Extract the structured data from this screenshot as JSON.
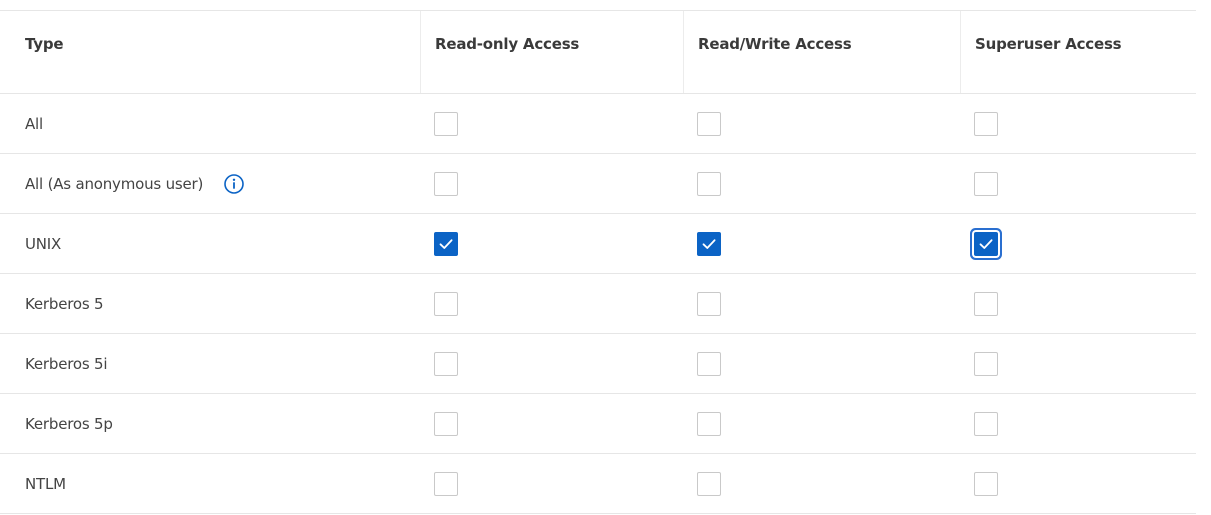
{
  "header": {
    "type": "Type",
    "read_only": "Read-only Access",
    "read_write": "Read/Write Access",
    "superuser": "Superuser Access"
  },
  "rows": [
    {
      "label": "All",
      "read_only": false,
      "read_write": false,
      "superuser": false,
      "info": false
    },
    {
      "label": "All (As anonymous user)",
      "read_only": false,
      "read_write": false,
      "superuser": false,
      "info": true
    },
    {
      "label": "UNIX",
      "read_only": true,
      "read_write": true,
      "superuser": true,
      "info": false
    },
    {
      "label": "Kerberos 5",
      "read_only": false,
      "read_write": false,
      "superuser": false,
      "info": false
    },
    {
      "label": "Kerberos 5i",
      "read_only": false,
      "read_write": false,
      "superuser": false,
      "info": false
    },
    {
      "label": "Kerberos 5p",
      "read_only": false,
      "read_write": false,
      "superuser": false,
      "info": false
    },
    {
      "label": "NTLM",
      "read_only": false,
      "read_write": false,
      "superuser": false,
      "info": false
    }
  ],
  "colors": {
    "accent": "#0b63c5",
    "border": "#e6e6e6",
    "checkbox_border": "#c9c9c9",
    "text": "#3b3b3b"
  },
  "icons": {
    "info": "info-circle-icon",
    "check": "checkmark-icon"
  }
}
